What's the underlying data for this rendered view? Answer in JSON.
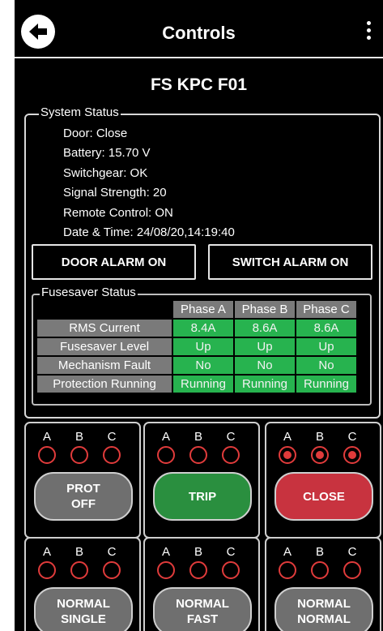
{
  "header": {
    "title": "Controls"
  },
  "device": {
    "name": "FS KPC F01"
  },
  "system_status": {
    "legend": "System Status",
    "lines": [
      "Door: Close",
      "Battery: 15.70 V",
      "Switchgear: OK",
      "Signal Strength: 20",
      "Remote Control: ON",
      "Date & Time: 24/08/20,14:19:40"
    ]
  },
  "alarms": {
    "door": "DOOR ALARM ON",
    "switch": "SWITCH ALARM ON"
  },
  "fusesaver": {
    "legend": "Fusesaver Status",
    "headers": [
      "Phase A",
      "Phase B",
      "Phase C"
    ],
    "rows": [
      {
        "label": "RMS Current",
        "values": [
          "8.4A",
          "8.6A",
          "8.6A"
        ]
      },
      {
        "label": "Fusesaver Level",
        "values": [
          "Up",
          "Up",
          "Up"
        ]
      },
      {
        "label": "Mechanism Fault",
        "values": [
          "No",
          "No",
          "No"
        ]
      },
      {
        "label": "Protection Running",
        "values": [
          "Running",
          "Running",
          "Running"
        ]
      }
    ]
  },
  "phase_labels": [
    "A",
    "B",
    "C"
  ],
  "controls": [
    {
      "button": "PROT\nOFF",
      "style": "gray",
      "indicators_on": [
        false,
        false,
        false
      ]
    },
    {
      "button": "TRIP",
      "style": "green",
      "indicators_on": [
        false,
        false,
        false
      ]
    },
    {
      "button": "CLOSE",
      "style": "red",
      "indicators_on": [
        true,
        true,
        true
      ]
    },
    {
      "button": "NORMAL\nSINGLE",
      "style": "gray",
      "indicators_on": [
        false,
        false,
        false
      ]
    },
    {
      "button": "NORMAL\nFAST",
      "style": "gray",
      "indicators_on": [
        false,
        false,
        false
      ]
    },
    {
      "button": "NORMAL\nNORMAL",
      "style": "gray",
      "indicators_on": [
        false,
        false,
        false
      ]
    }
  ],
  "colors": {
    "status_green": "#27b34f",
    "indicator_red": "#e03b3b",
    "close_red": "#c8333f",
    "trip_green": "#2a8f3f"
  }
}
